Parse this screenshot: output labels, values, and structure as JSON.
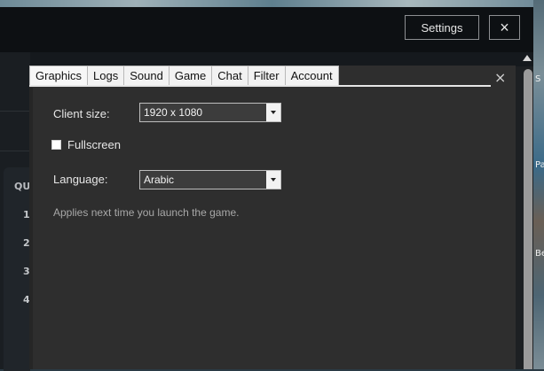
{
  "host": {
    "settings_label": "Settings",
    "close_label": "×",
    "card_title": "QU",
    "card_numbers": [
      "1",
      "2",
      "3",
      "4"
    ]
  },
  "edge_labels": [
    "S",
    "Pa",
    "Be"
  ],
  "dialog": {
    "tabs": [
      {
        "label": "Graphics",
        "active": true
      },
      {
        "label": "Logs",
        "active": false
      },
      {
        "label": "Sound",
        "active": false
      },
      {
        "label": "Game",
        "active": false
      },
      {
        "label": "Chat",
        "active": false
      },
      {
        "label": "Filter",
        "active": false
      },
      {
        "label": "Account",
        "active": false
      }
    ],
    "close_label": "×",
    "client_size": {
      "label": "Client size:",
      "value": "1920 x 1080"
    },
    "fullscreen": {
      "label": "Fullscreen",
      "checked": false
    },
    "language": {
      "label": "Language:",
      "value": "Arabic"
    },
    "note": "Applies next time you launch the game."
  }
}
